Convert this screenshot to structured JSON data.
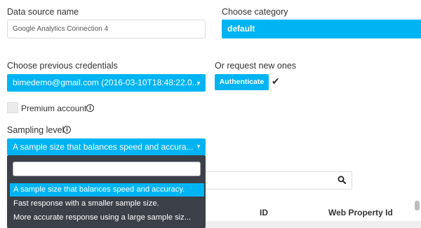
{
  "form": {
    "data_source_name_label": "Data source name",
    "data_source_name_value": "Google Analytics Connection 4",
    "category_label": "Choose category",
    "category_value": "default",
    "credentials_label": "Choose previous credentials",
    "credentials_value": "bimedemo@gmail.com (2016-03-10T18:48:22.0...",
    "request_new_label": "Or request new ones",
    "authenticate_label": "Authenticate",
    "check_mark": "✔",
    "premium_label": "Premium account",
    "sampling_label": "Sampling level",
    "sampling_value": "A sample size that balances speed and accura...",
    "info_glyph": "i"
  },
  "sampling_dropdown": {
    "search_value": "",
    "options": [
      "A sample size that balances speed and accuracy.",
      "Fast response with a smaller sample size.",
      "More accurate response using a large sample siz..."
    ],
    "selected_index": 0
  },
  "table": {
    "search_value": "",
    "columns": [
      "ID",
      "Web Property Id"
    ]
  },
  "colors": {
    "accent": "#00b4f4",
    "dropdown_bg": "#3c4048"
  },
  "icons": [
    "info-icon",
    "search-icon",
    "check-icon",
    "chevron-down-icon"
  ]
}
